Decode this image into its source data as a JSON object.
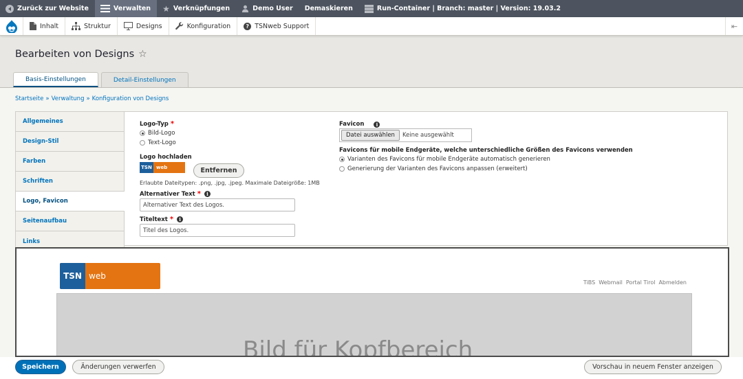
{
  "topbar": {
    "items": [
      {
        "label": "Zurück zur Website",
        "icon": "back-circle-icon"
      },
      {
        "label": "Verwalten",
        "icon": "menu-icon"
      },
      {
        "label": "Verknüpfungen",
        "icon": "star-icon"
      },
      {
        "label": "Demo User",
        "icon": "user-icon"
      },
      {
        "label": "Demaskieren"
      },
      {
        "label": "Run-Container | Branch: master | Version: 19.03.2",
        "icon": "server-icon"
      }
    ]
  },
  "tray": {
    "items": [
      {
        "label": "Inhalt",
        "icon": "file-icon"
      },
      {
        "label": "Struktur",
        "icon": "sitemap-icon"
      },
      {
        "label": "Designs",
        "icon": "monitor-icon"
      },
      {
        "label": "Konfiguration",
        "icon": "wrench-icon"
      },
      {
        "label": "TSNweb Support",
        "icon": "help-icon"
      }
    ]
  },
  "page": {
    "title": "Bearbeiten von Designs",
    "tabs": [
      "Basis-Einstellungen",
      "Detail-Einstellungen"
    ],
    "breadcrumb": [
      "Startseite",
      "Verwaltung",
      "Konfiguration von Designs"
    ],
    "breadcrumb_sep": "»"
  },
  "vtabs": [
    "Allgemeines",
    "Design-Stil",
    "Farben",
    "Schriften",
    "Logo, Favicon",
    "Seitenaufbau",
    "Links"
  ],
  "form": {
    "logo_type_label": "Logo-Typ",
    "req": "*",
    "logo_type_options": [
      "Bild-Logo",
      "Text-Logo"
    ],
    "logo_upload_label": "Logo hochladen",
    "logo_thumb_a": "TSN",
    "logo_thumb_b": "web",
    "remove_button": "Entfernen",
    "allowed_types": "Erlaubte Dateitypen: .png, .jpg, .jpeg. Maximale Dateigröße: 1MB",
    "alt_text_label": "Alternativer Text",
    "alt_text_value": "Alternativer Text des Logos.",
    "title_text_label": "Titeltext",
    "title_text_value": "Titel des Logos.",
    "favicon_label": "Favicon",
    "file_button": "Datei auswählen",
    "file_none": "Keine ausgewählt",
    "mobile_label": "Favicons für mobile Endgeräte, welche unterschiedliche Größen des Favicons verwenden",
    "mobile_options": [
      "Varianten des Favicons für mobile Endgeräte automatisch generieren",
      "Generierung der Varianten des Favicons anpassen (erweitert)"
    ],
    "info_glyph": "i"
  },
  "preview": {
    "logo_a": "TSN",
    "logo_b": "web",
    "links": [
      "TiBS",
      "Webmail",
      "Portal Tirol",
      "Abmelden"
    ],
    "header_text": "Bild für Kopfbereich"
  },
  "actions": {
    "save": "Speichern",
    "discard": "Änderungen verwerfen",
    "preview": "Vorschau in neuem Fenster anzeigen"
  },
  "colors": {
    "toolbar": "#4d545f",
    "link": "#0074bd",
    "primary": "#0071b8",
    "logo_blue": "#1d5f9c",
    "logo_orange": "#e37411"
  }
}
